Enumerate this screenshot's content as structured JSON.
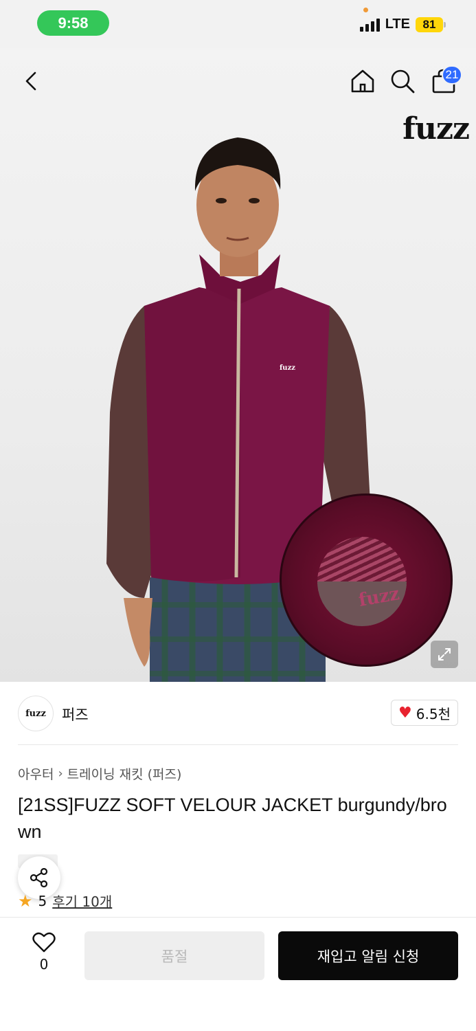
{
  "status_bar": {
    "time": "9:58",
    "network": "LTE",
    "battery": "81"
  },
  "header": {
    "back_icon": "chevron-left-icon",
    "home_icon": "home-icon",
    "search_icon": "search-icon",
    "cart_icon": "shopping-bag-icon",
    "cart_count": "21"
  },
  "hero": {
    "brand_logo": "fuzz",
    "patch_logo": "fuzz",
    "chest_logo": "fuzz",
    "expand_icon": "expand-icon"
  },
  "brand": {
    "logo_text": "fuzz",
    "name": "퍼즈",
    "likes": "6.5천"
  },
  "breadcrumb": {
    "category": "아우터",
    "subcategory": "트레이닝 재킷 (퍼즈)"
  },
  "product": {
    "title": "[21SS]FUZZ SOFT VELOUR JACKET burgundy/brown"
  },
  "rating": {
    "score": "5",
    "reviews": "후기 10개"
  },
  "bottom_bar": {
    "wish_count": "0",
    "soldout_label": "품절",
    "notify_label": "재입고 알림 신청"
  },
  "colors": {
    "accent_blue": "#2f6bff",
    "like_red": "#e8232f",
    "star": "#f5a623",
    "primary_button": "#0a0a0a"
  }
}
